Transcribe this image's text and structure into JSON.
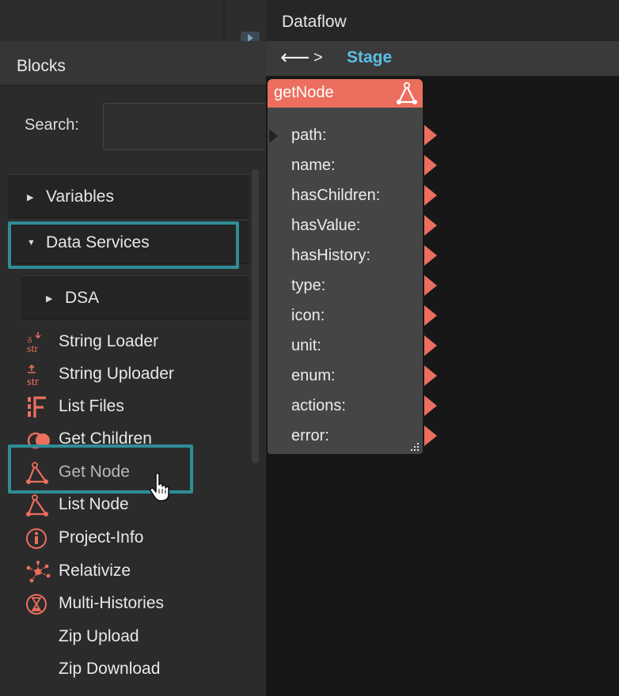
{
  "dataflow": {
    "title": "Dataflow",
    "breadcrumb_sep": ">",
    "breadcrumb_current": "Stage"
  },
  "blocks": {
    "title": "Blocks",
    "search_label": "Search:",
    "search_value": "",
    "categories": [
      {
        "label": "Variables",
        "arrow": "▶"
      },
      {
        "label": "Data Services",
        "arrow": "▼"
      },
      {
        "label": "DSA",
        "arrow": "▶"
      }
    ],
    "items": [
      {
        "label": "String Loader",
        "icon": "string-loader-icon"
      },
      {
        "label": "String Uploader",
        "icon": "string-uploader-icon"
      },
      {
        "label": "List Files",
        "icon": "list-files-icon"
      },
      {
        "label": "Get Children",
        "icon": "get-children-icon"
      },
      {
        "label": "Get Node",
        "icon": "get-node-icon"
      },
      {
        "label": "List Node",
        "icon": "list-node-icon"
      },
      {
        "label": "Project-Info",
        "icon": "info-icon"
      },
      {
        "label": "Relativize",
        "icon": "relativize-icon"
      },
      {
        "label": "Multi-Histories",
        "icon": "multi-histories-icon"
      },
      {
        "label": "Zip Upload",
        "icon": ""
      },
      {
        "label": "Zip Download",
        "icon": ""
      }
    ]
  },
  "node": {
    "title": "getNode",
    "ports": [
      "path:",
      "name:",
      "hasChildren:",
      "hasValue:",
      "hasHistory:",
      "type:",
      "icon:",
      "unit:",
      "enum:",
      "actions:",
      "error:"
    ]
  },
  "colors": {
    "accent": "#ec6e5e",
    "highlight": "#2f8d96",
    "breadcrumb": "#5bbfe5"
  }
}
